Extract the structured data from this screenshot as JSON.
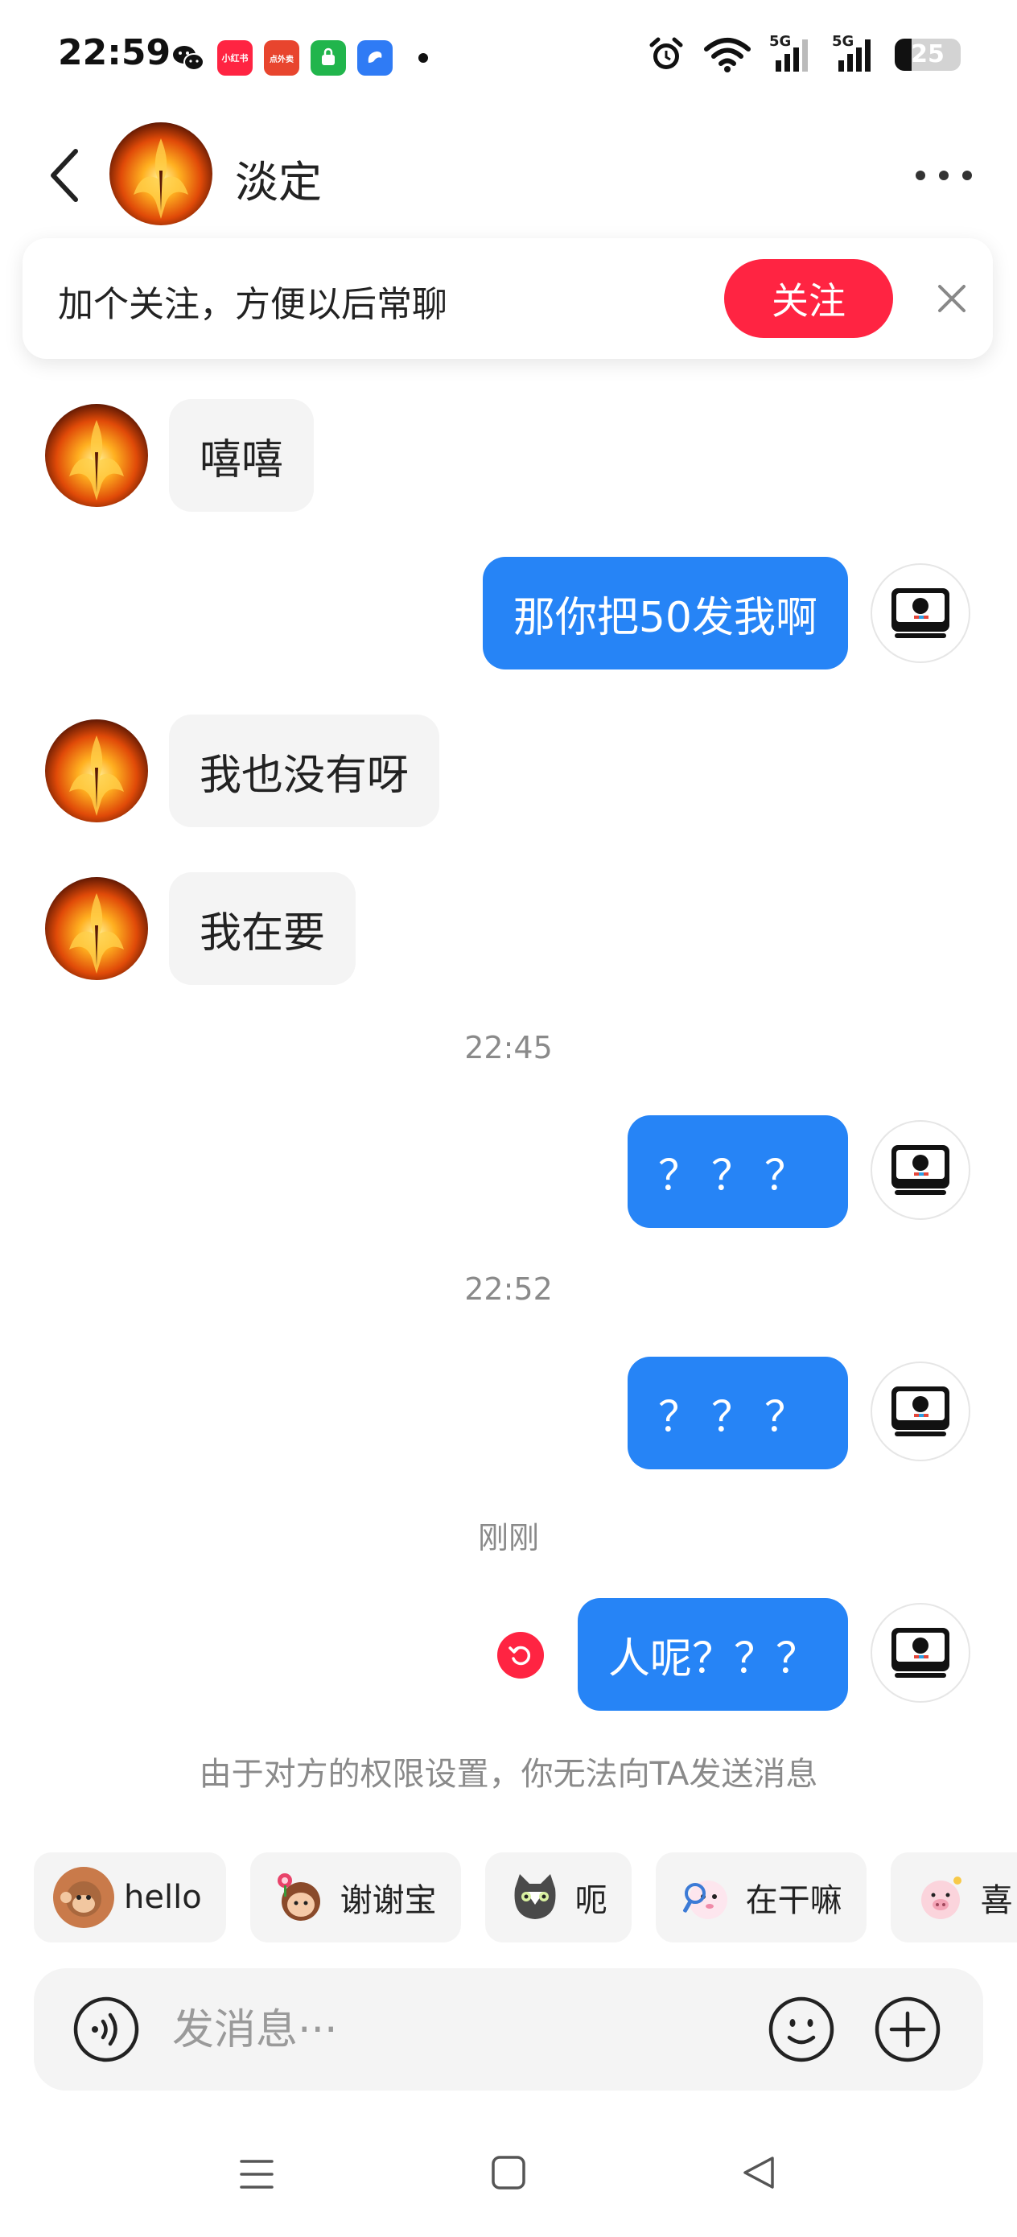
{
  "status_bar": {
    "time": "22:59",
    "battery_level": "25",
    "network_1": "5G",
    "network_2": "5G",
    "app_icons": [
      "wechat-icon",
      "xiaohongshu-icon",
      "waimai-icon",
      "green-app-icon",
      "blue-app-icon"
    ],
    "xiaohongshu_label": "小红书",
    "waimai_label": "点外卖"
  },
  "header": {
    "contact_name": "淡定"
  },
  "follow_banner": {
    "text": "加个关注，方便以后常聊",
    "button_label": "关注"
  },
  "messages": [
    {
      "side": "in",
      "text": "嘻嘻"
    },
    {
      "side": "out",
      "text": "那你把50发我啊"
    },
    {
      "side": "in",
      "text": "我也没有呀"
    },
    {
      "side": "in",
      "text": "我在要"
    },
    {
      "type": "time",
      "text": "22:45"
    },
    {
      "side": "out",
      "text": "？？？"
    },
    {
      "type": "time",
      "text": "22:52"
    },
    {
      "side": "out",
      "text": "？？？"
    },
    {
      "type": "time",
      "text": "刚刚"
    },
    {
      "side": "out",
      "text": "人呢？？？",
      "failed": true
    }
  ],
  "notice": "由于对方的权限设置，你无法向TA发送消息",
  "quick_replies": [
    {
      "label": "hello",
      "icon": "monkey-emoji-icon"
    },
    {
      "label": "谢谢宝",
      "icon": "girl-flower-emoji-icon"
    },
    {
      "label": "呃",
      "icon": "cat-emoji-icon"
    },
    {
      "label": "在干嘛",
      "icon": "peeking-emoji-icon"
    },
    {
      "label": "喜",
      "icon": "pig-emoji-icon"
    }
  ],
  "input": {
    "placeholder": "发消息···"
  },
  "colors": {
    "accent_red": "#ff2442",
    "bubble_blue": "#2684f6",
    "bubble_gray": "#f4f4f4"
  }
}
